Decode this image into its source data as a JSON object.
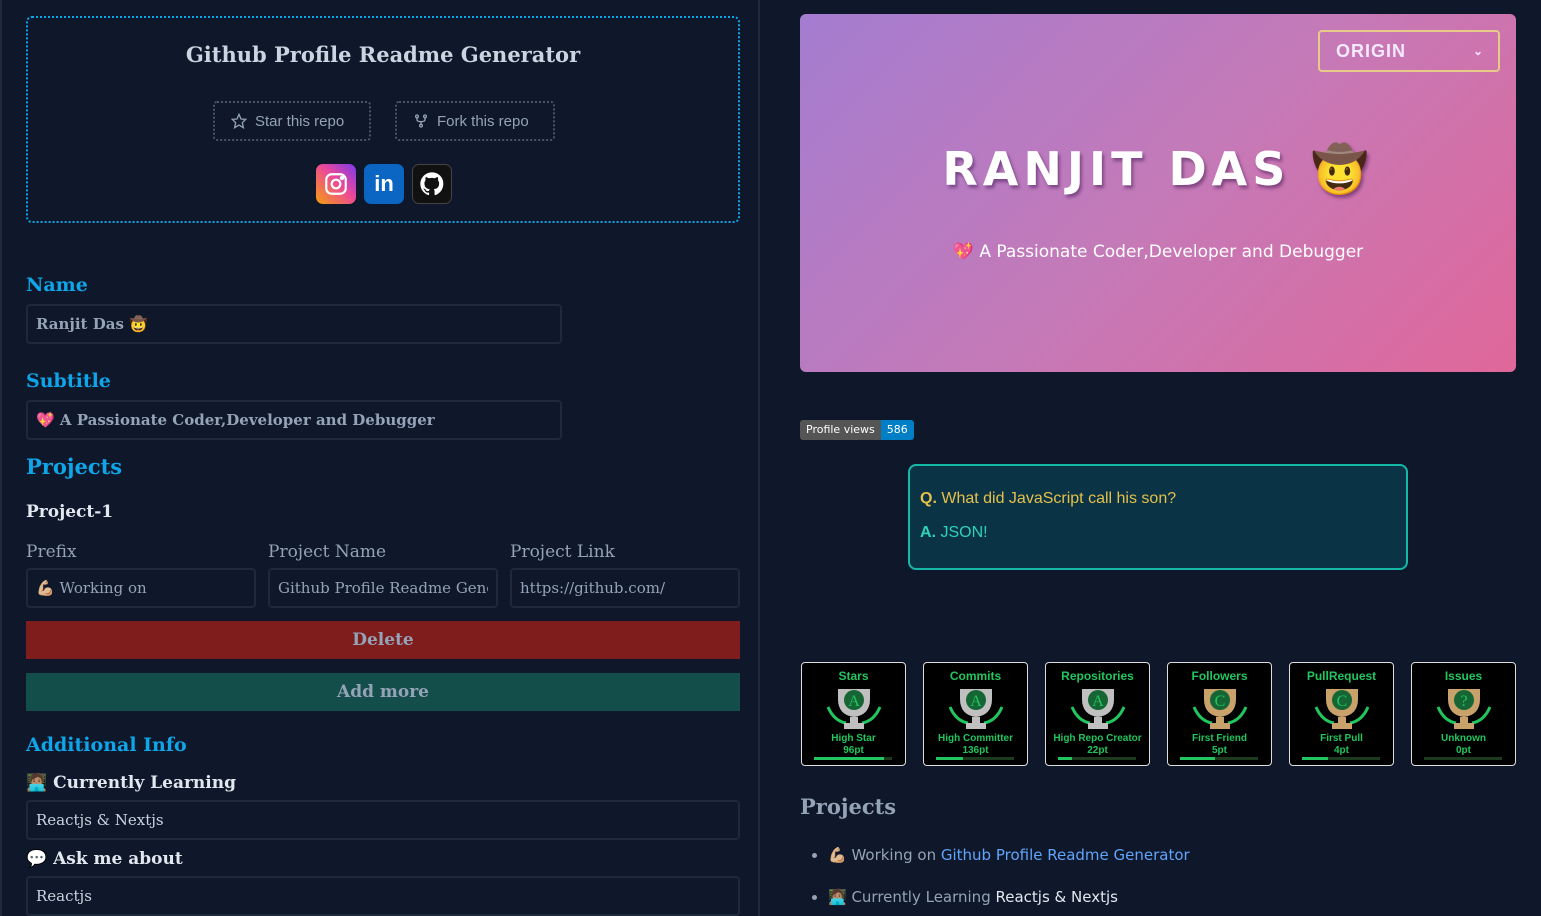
{
  "header": {
    "title": "Github Profile Readme Generator",
    "star_label": "Star this repo",
    "fork_label": "Fork this repo"
  },
  "socials": [
    {
      "name": "instagram",
      "icon": "instagram-icon"
    },
    {
      "name": "linkedin",
      "icon": "linkedin-icon",
      "glyph": "in"
    },
    {
      "name": "github",
      "icon": "github-icon"
    }
  ],
  "form": {
    "name_label": "Name",
    "name_value": "Ranjit Das 🤠",
    "subtitle_label": "Subtitle",
    "subtitle_value": "💖 A Passionate Coder,Developer and Debugger",
    "projects_label": "Projects",
    "project_title": "Project-1",
    "prefix_label": "Prefix",
    "prefix_value": "💪🏼 Working on",
    "project_name_label": "Project Name",
    "project_name_value": "Github Profile Readme Generator",
    "project_link_label": "Project Link",
    "project_link_value": "https://github.com/",
    "delete_label": "Delete",
    "add_more_label": "Add more",
    "additional_label": "Additional Info",
    "learning_label": "🧑🏽‍💻 Currently Learning",
    "learning_value": "Reactjs & Nextjs",
    "ask_label": "💬 Ask me about",
    "ask_value": "Reactjs"
  },
  "preview": {
    "theme_selected": "ORIGIN",
    "banner_name": "RANJIT DAS 🤠",
    "banner_subtitle": "💖 A Passionate Coder,Developer and Debugger",
    "views_label": "Profile views",
    "views_count": "586",
    "joke": {
      "q_prefix": "Q.",
      "question": "What did JavaScript call his son?",
      "a_prefix": "A.",
      "answer": "JSON!"
    },
    "trophies": [
      {
        "title": "Stars",
        "rank": "A",
        "sub": "High Star",
        "pt": "96pt",
        "progress": 0.9,
        "color": "#c0c0c0"
      },
      {
        "title": "Commits",
        "rank": "A",
        "sub": "High Committer",
        "pt": "136pt",
        "progress": 0.35,
        "color": "#c0c0c0"
      },
      {
        "title": "Repositories",
        "rank": "A",
        "sub": "High Repo Creator",
        "pt": "22pt",
        "progress": 0.18,
        "color": "#c0c0c0"
      },
      {
        "title": "Followers",
        "rank": "C",
        "sub": "First Friend",
        "pt": "5pt",
        "progress": 0.45,
        "color": "#c9a26b"
      },
      {
        "title": "PullRequest",
        "rank": "C",
        "sub": "First Pull",
        "pt": "4pt",
        "progress": 0.33,
        "color": "#c9a26b"
      },
      {
        "title": "Issues",
        "rank": "?",
        "sub": "Unknown",
        "pt": "0pt",
        "progress": 0.0,
        "color": "#c9a26b"
      }
    ],
    "projects_heading": "Projects",
    "project_prefix": "💪🏼 Working on",
    "project_link_text": "Github Profile Readme Generator",
    "learning_prefix": "🧑🏽‍💻 Currently Learning",
    "learning_value": "Reactjs & Nextjs"
  }
}
